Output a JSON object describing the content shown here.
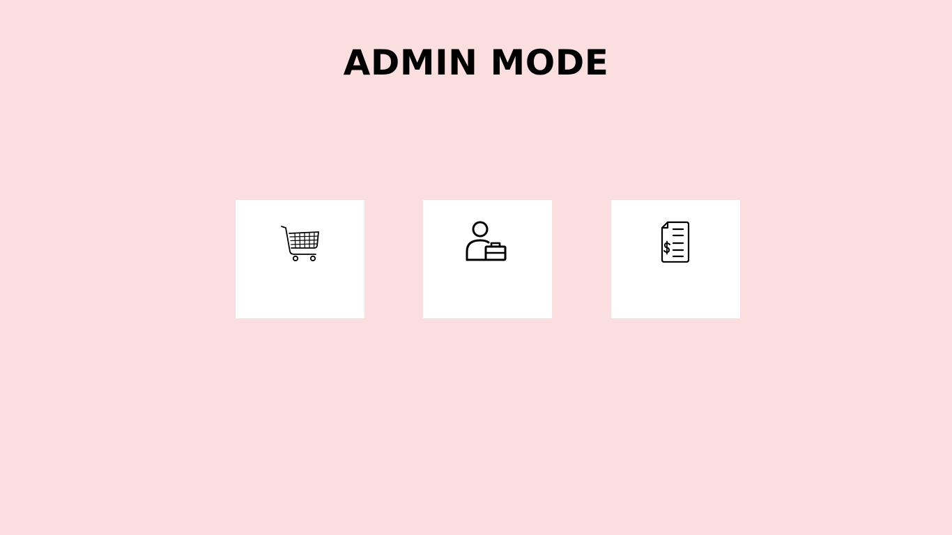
{
  "header": {
    "title": "ADMIN MODE"
  },
  "tiles": [
    {
      "icon": "shopping-cart-icon"
    },
    {
      "icon": "employee-briefcase-icon"
    },
    {
      "icon": "invoice-dollar-icon"
    }
  ],
  "colors": {
    "background": "#fbdfe0",
    "tile": "#ffffff",
    "text": "#000000"
  }
}
